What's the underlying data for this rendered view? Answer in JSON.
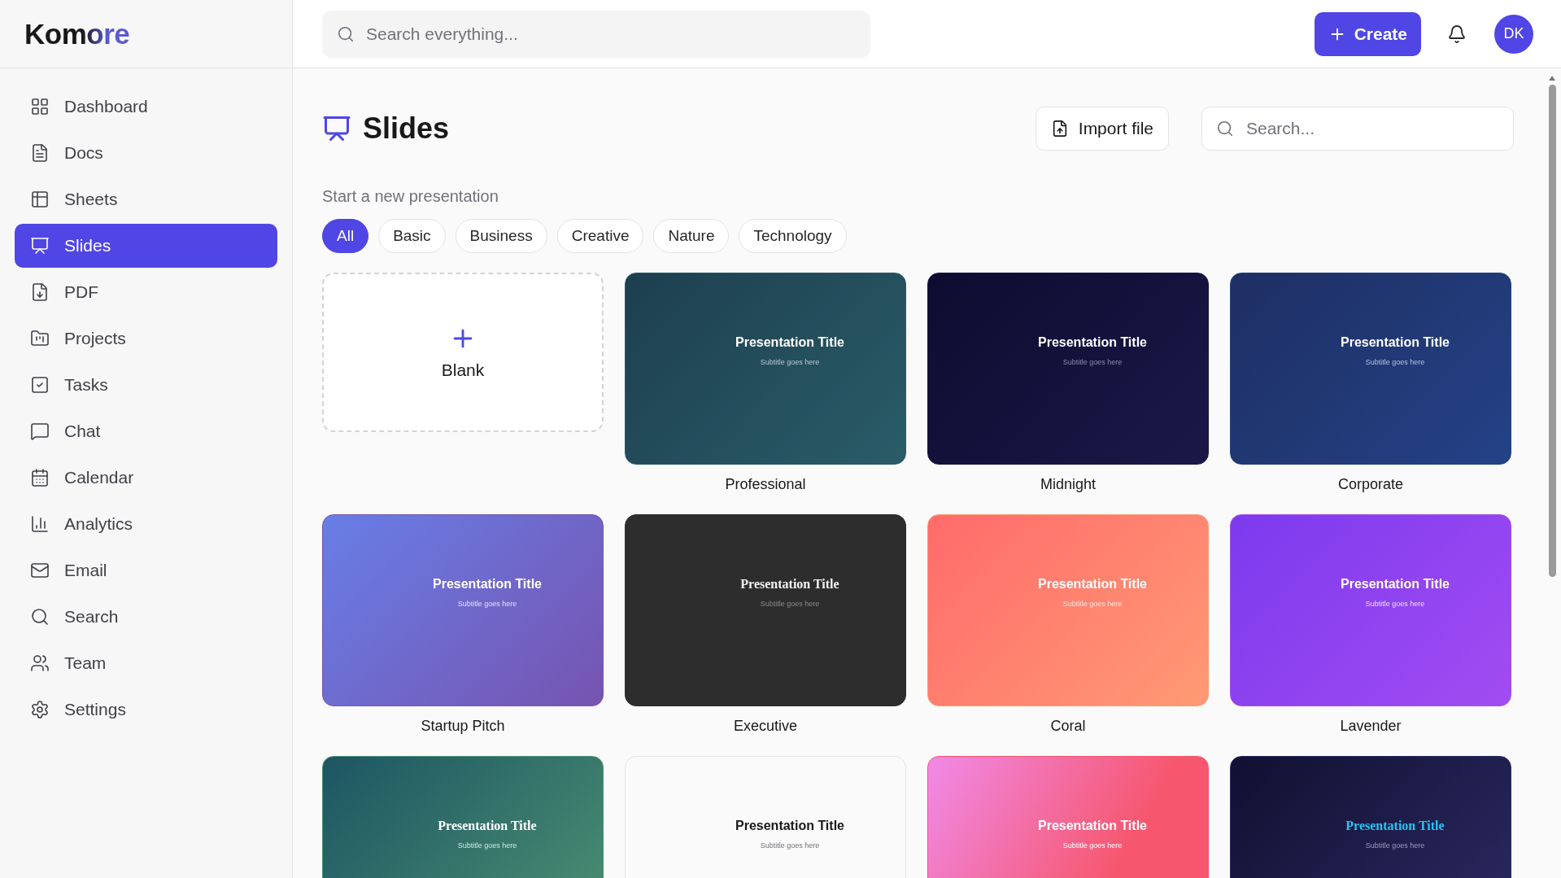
{
  "brand": {
    "name": "Komore"
  },
  "sidebar": {
    "items": [
      {
        "label": "Dashboard",
        "selected": false
      },
      {
        "label": "Docs",
        "selected": false
      },
      {
        "label": "Sheets",
        "selected": false
      },
      {
        "label": "Slides",
        "selected": true
      },
      {
        "label": "PDF",
        "selected": false
      },
      {
        "label": "Projects",
        "selected": false
      },
      {
        "label": "Tasks",
        "selected": false
      },
      {
        "label": "Chat",
        "selected": false
      },
      {
        "label": "Calendar",
        "selected": false
      },
      {
        "label": "Analytics",
        "selected": false
      },
      {
        "label": "Email",
        "selected": false
      },
      {
        "label": "Search",
        "selected": false
      },
      {
        "label": "Team",
        "selected": false
      },
      {
        "label": "Settings",
        "selected": false
      }
    ]
  },
  "topbar": {
    "search": {
      "placeholder": "Search everything..."
    },
    "create_button": "Create",
    "avatar": "DK"
  },
  "page": {
    "title": "Slides",
    "import_button": "Import file",
    "search": {
      "placeholder": "Search..."
    },
    "section_title": "Start a new presentation"
  },
  "filters": [
    {
      "label": "All",
      "selected": true
    },
    {
      "label": "Basic",
      "selected": false
    },
    {
      "label": "Business",
      "selected": false
    },
    {
      "label": "Creative",
      "selected": false
    },
    {
      "label": "Nature",
      "selected": false
    },
    {
      "label": "Technology",
      "selected": false
    }
  ],
  "templates": [
    {
      "kind": "blank",
      "name": "Blank"
    },
    {
      "kind": "teal",
      "name": "Professional",
      "title": "Presentation Title",
      "subtitle": "Subtitle goes here"
    },
    {
      "kind": "midnight",
      "name": "Midnight",
      "title": "Presentation Title",
      "subtitle": "Subtitle goes here"
    },
    {
      "kind": "navy",
      "name": "Corporate",
      "title": "Presentation Title",
      "subtitle": "Subtitle goes here"
    },
    {
      "kind": "violet",
      "name": "Startup Pitch",
      "title": "Presentation Title",
      "subtitle": "Subtitle goes here"
    },
    {
      "kind": "charcoal",
      "name": "Executive",
      "title": "Presentation Title",
      "subtitle": "Subtitle goes here"
    },
    {
      "kind": "coral",
      "name": "Coral",
      "title": "Presentation Title",
      "subtitle": "Subtitle goes here"
    },
    {
      "kind": "purple",
      "name": "Lavender",
      "title": "Presentation Title",
      "subtitle": "Subtitle goes here"
    },
    {
      "kind": "forest",
      "title": "Presentation Title",
      "subtitle": "Subtitle goes here"
    },
    {
      "kind": "light",
      "title": "Presentation Title",
      "subtitle": "Subtitle goes here"
    },
    {
      "kind": "pink",
      "title": "Presentation Title",
      "subtitle": "Subtitle goes here"
    },
    {
      "kind": "neon",
      "title": "Presentation Title",
      "subtitle": "Subtitle goes here"
    }
  ]
}
